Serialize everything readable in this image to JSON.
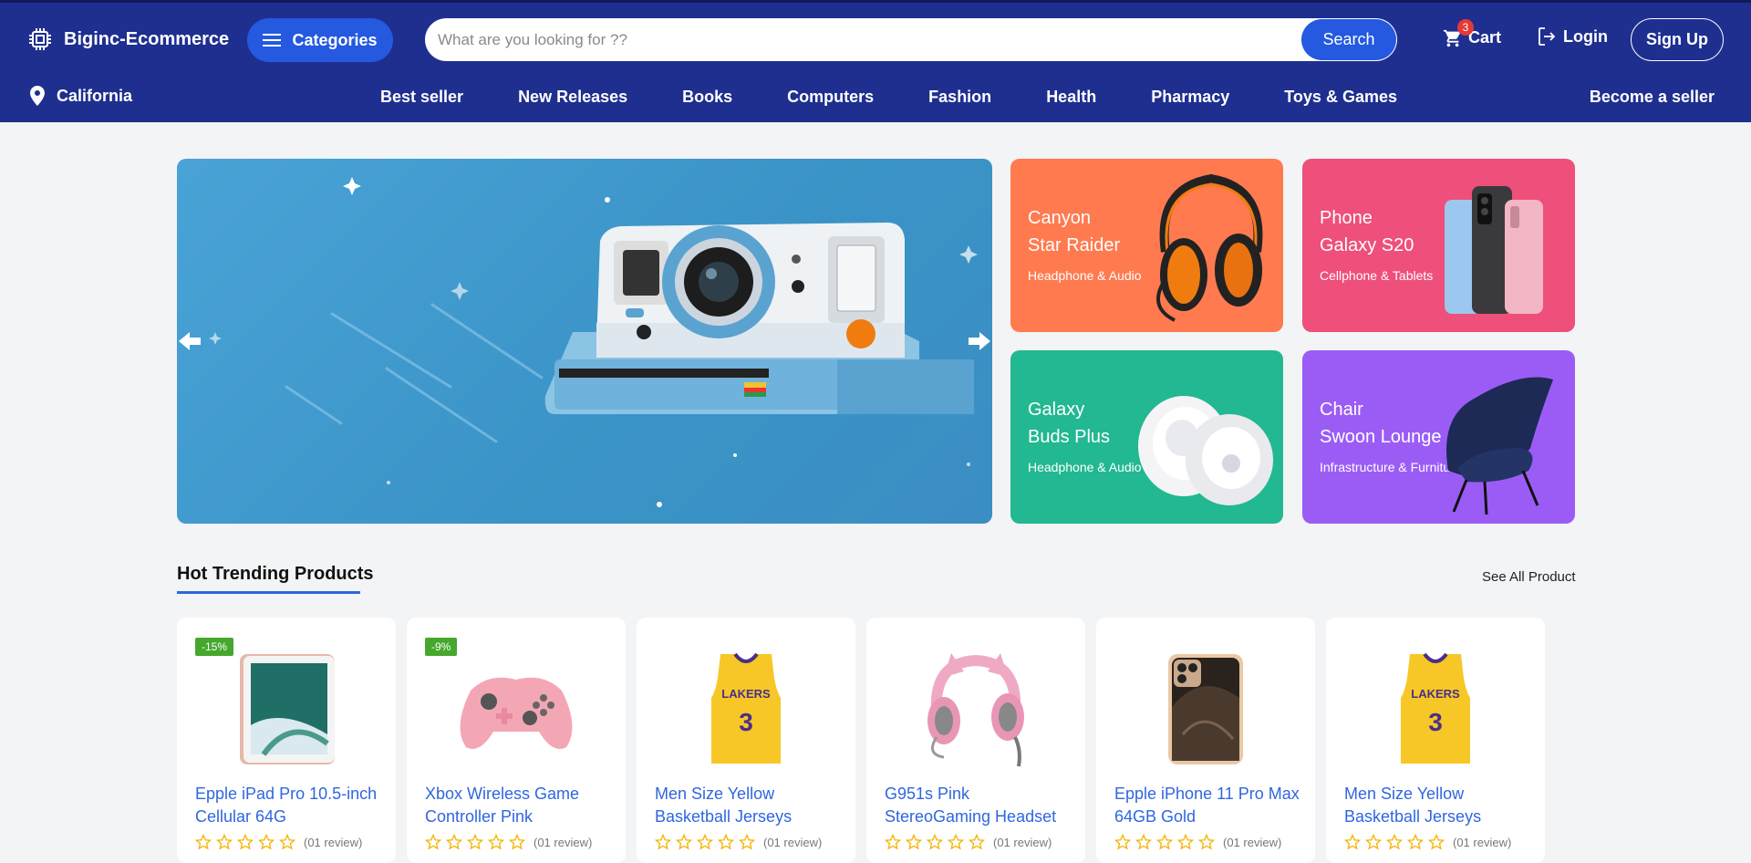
{
  "header": {
    "brand": "Biginc-Ecommerce",
    "categories_label": "Categories",
    "search": {
      "placeholder": "What are you looking for ??",
      "value": "",
      "button_label": "Search"
    },
    "cart": {
      "label": "Cart",
      "count": "3"
    },
    "login_label": "Login",
    "signup_label": "Sign Up",
    "location": "California",
    "nav": [
      "Best seller",
      "New Releases",
      "Books",
      "Computers",
      "Fashion",
      "Health",
      "Pharmacy",
      "Toys & Games"
    ],
    "become_seller": "Become a seller"
  },
  "colors": {
    "header_bg": "#1e2f8f",
    "accent": "#2459e0",
    "link": "#2f66e0",
    "discount_badge": "#45a82d",
    "promo_orange": "#ff7a4f",
    "promo_pink": "#ef4f7b",
    "promo_green": "#22b891",
    "promo_purple": "#9b5cf6"
  },
  "hero": {
    "icon": "instant-camera-image"
  },
  "promos": [
    {
      "title_line1": "Canyon",
      "title_line2": "Star Raider",
      "subtitle": "Headphone & Audio",
      "icon": "gaming-headset-image"
    },
    {
      "title_line1": "Phone",
      "title_line2": "Galaxy S20",
      "subtitle": "Cellphone & Tablets",
      "icon": "smartphones-image"
    },
    {
      "title_line1": "Galaxy",
      "title_line2": "Buds Plus",
      "subtitle": "Headphone & Audio",
      "icon": "earbuds-image"
    },
    {
      "title_line1": "Chair",
      "title_line2": "Swoon Lounge",
      "subtitle": "Infrastructure & Furniture",
      "icon": "lounge-chair-image"
    }
  ],
  "trending": {
    "title": "Hot Trending Products",
    "see_all": "See All Product",
    "products": [
      {
        "name": "Epple iPad Pro 10.5-inch Cellular 64G",
        "badge": "-15%",
        "reviews": "(01 review)",
        "rating": 0,
        "icon": "tablet-image"
      },
      {
        "name": "Xbox Wireless Game Controller Pink",
        "badge": "-9%",
        "reviews": "(01 review)",
        "rating": 0,
        "icon": "game-controller-image"
      },
      {
        "name": "Men Size Yellow Basketball Jerseys",
        "badge": "",
        "reviews": "(01 review)",
        "rating": 0,
        "icon": "jersey-image"
      },
      {
        "name": "G951s Pink StereoGaming Headset",
        "badge": "",
        "reviews": "(01 review)",
        "rating": 0,
        "icon": "pink-headset-image"
      },
      {
        "name": "Epple iPhone 11 Pro Max 64GB Gold",
        "badge": "",
        "reviews": "(01 review)",
        "rating": 0,
        "icon": "iphone-image"
      },
      {
        "name": "Men Size Yellow Basketball Jerseys",
        "badge": "",
        "reviews": "(01 review)",
        "rating": 0,
        "icon": "jersey-image"
      }
    ]
  }
}
